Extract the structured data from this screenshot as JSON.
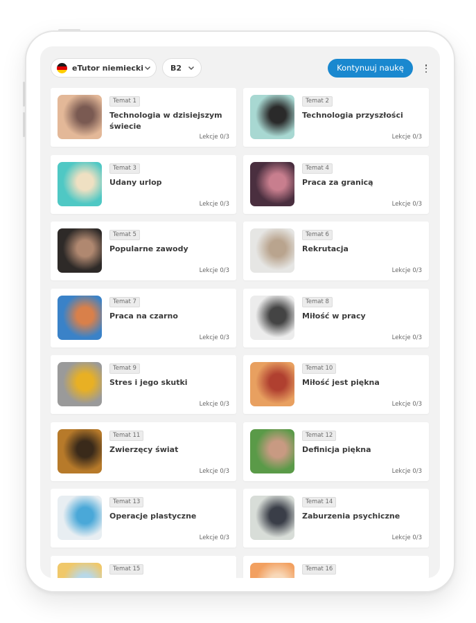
{
  "toolbar": {
    "language_label": "eTutor niemiecki",
    "level_label": "B2",
    "continue_label": "Kontynuuj naukę",
    "flag_colors": [
      "#1a1a1a",
      "#dd0000",
      "#ffce00"
    ]
  },
  "topics": [
    {
      "tag": "Temat 1",
      "title": "Technologia w dzisiejszym świecie",
      "lessons": "Lekcje 0/3",
      "image": "hands-with-devices",
      "colors": [
        "#e3b898",
        "#7a5a52"
      ]
    },
    {
      "tag": "Temat 2",
      "title": "Technologia przyszłości",
      "lessons": "Lekcje 0/3",
      "image": "robot-head",
      "colors": [
        "#a8d8d2",
        "#2a2a2a"
      ]
    },
    {
      "tag": "Temat 3",
      "title": "Udany urlop",
      "lessons": "Lekcje 0/3",
      "image": "woman-on-beach",
      "colors": [
        "#4fc8c4",
        "#efe0c2"
      ]
    },
    {
      "tag": "Temat 4",
      "title": "Praca za granicą",
      "lessons": "Lekcje 0/3",
      "image": "welder",
      "colors": [
        "#4a2f3f",
        "#c87e8e"
      ]
    },
    {
      "tag": "Temat 5",
      "title": "Popularne zawody",
      "lessons": "Lekcje 0/3",
      "image": "chef",
      "colors": [
        "#2e2a28",
        "#b08870"
      ]
    },
    {
      "tag": "Temat 6",
      "title": "Rekrutacja",
      "lessons": "Lekcje 0/3",
      "image": "interview-hands",
      "colors": [
        "#e6e6e4",
        "#b9a48e"
      ]
    },
    {
      "tag": "Temat 7",
      "title": "Praca na czarno",
      "lessons": "Lekcje 0/3",
      "image": "bricklayer",
      "colors": [
        "#3a82c8",
        "#d9804a"
      ]
    },
    {
      "tag": "Temat 8",
      "title": "Miłość w pracy",
      "lessons": "Lekcje 0/3",
      "image": "office-kiss",
      "colors": [
        "#ececec",
        "#444444"
      ]
    },
    {
      "tag": "Temat 9",
      "title": "Stres i jego skutki",
      "lessons": "Lekcje 0/3",
      "image": "stressed-woman",
      "colors": [
        "#9a9a9a",
        "#e8b024"
      ]
    },
    {
      "tag": "Temat 10",
      "title": "Miłość jest piękna",
      "lessons": "Lekcje 0/3",
      "image": "elderly-couple",
      "colors": [
        "#e8a060",
        "#b04030"
      ]
    },
    {
      "tag": "Temat 11",
      "title": "Zwierzęcy świat",
      "lessons": "Lekcje 0/3",
      "image": "leopard",
      "colors": [
        "#b77a2a",
        "#3a2a1a"
      ]
    },
    {
      "tag": "Temat 12",
      "title": "Definicja piękna",
      "lessons": "Lekcje 0/3",
      "image": "woman-portrait",
      "colors": [
        "#5a9a48",
        "#c89a82"
      ]
    },
    {
      "tag": "Temat 13",
      "title": "Operacje plastyczne",
      "lessons": "Lekcje 0/3",
      "image": "plastic-surgery",
      "colors": [
        "#e8eef2",
        "#4aa8d8"
      ]
    },
    {
      "tag": "Temat 14",
      "title": "Zaburzenia psychiczne",
      "lessons": "Lekcje 0/3",
      "image": "sad-person",
      "colors": [
        "#d8ddd8",
        "#3a3e48"
      ]
    },
    {
      "tag": "Temat 15",
      "title": "",
      "lessons": "",
      "image": "juice-glass",
      "colors": [
        "#f0c86a",
        "#b8d8e8"
      ]
    },
    {
      "tag": "Temat 16",
      "title": "",
      "lessons": "",
      "image": "peach-object",
      "colors": [
        "#f2a060",
        "#f8d8b8"
      ]
    }
  ]
}
